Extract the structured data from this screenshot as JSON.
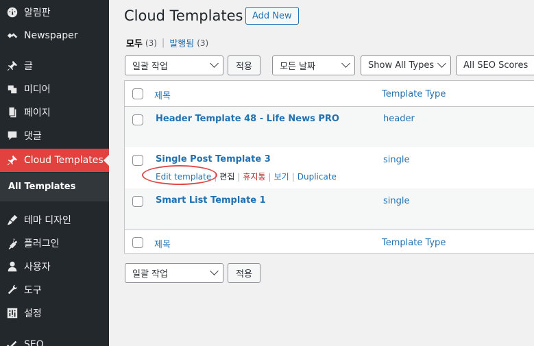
{
  "sidebar": {
    "items": [
      {
        "label": "알림판",
        "icon": "dashboard-icon"
      },
      {
        "label": "Newspaper",
        "icon": "newspaper-icon"
      },
      {
        "label": "글",
        "icon": "pin-icon"
      },
      {
        "label": "미디어",
        "icon": "media-icon"
      },
      {
        "label": "페이지",
        "icon": "page-icon"
      },
      {
        "label": "댓글",
        "icon": "comment-icon"
      },
      {
        "label": "Cloud Templates",
        "icon": "pin-icon"
      },
      {
        "label": "테마 디자인",
        "icon": "brush-icon"
      },
      {
        "label": "플러그인",
        "icon": "plugin-icon"
      },
      {
        "label": "사용자",
        "icon": "user-icon"
      },
      {
        "label": "도구",
        "icon": "wrench-icon"
      },
      {
        "label": "설정",
        "icon": "settings-icon"
      },
      {
        "label": "SEO",
        "icon": "seo-icon"
      }
    ],
    "submenu": {
      "label": "All Templates"
    }
  },
  "header": {
    "title": "Cloud Templates",
    "add_new": "Add New"
  },
  "filters": {
    "all_label": "모두",
    "all_count": "(3)",
    "published_label": "발행됨",
    "published_count": "(3)"
  },
  "toolbar_top": {
    "bulk_action": "일괄 작업",
    "apply": "적용",
    "date": "모든 날짜",
    "types": "Show All Types",
    "seo": "All SEO Scores"
  },
  "table": {
    "col_title": "제목",
    "col_type": "Template Type",
    "rows": [
      {
        "title": "Header Template 48 - Life News PRO",
        "type": "header"
      },
      {
        "title": "Single Post Template 3",
        "type": "single"
      },
      {
        "title": "Smart List Template 1",
        "type": "single"
      }
    ],
    "row_actions": {
      "edit_template": "Edit template",
      "edit": "편집",
      "trash": "휴지통",
      "view": "보기",
      "duplicate": "Duplicate"
    }
  },
  "toolbar_bottom": {
    "bulk_action": "일괄 작업",
    "apply": "적용"
  },
  "colors": {
    "sidebar_bg": "#23282d",
    "active_menu": "#e2423f",
    "link": "#2271b1",
    "highlight_circle": "#e04a4a"
  }
}
